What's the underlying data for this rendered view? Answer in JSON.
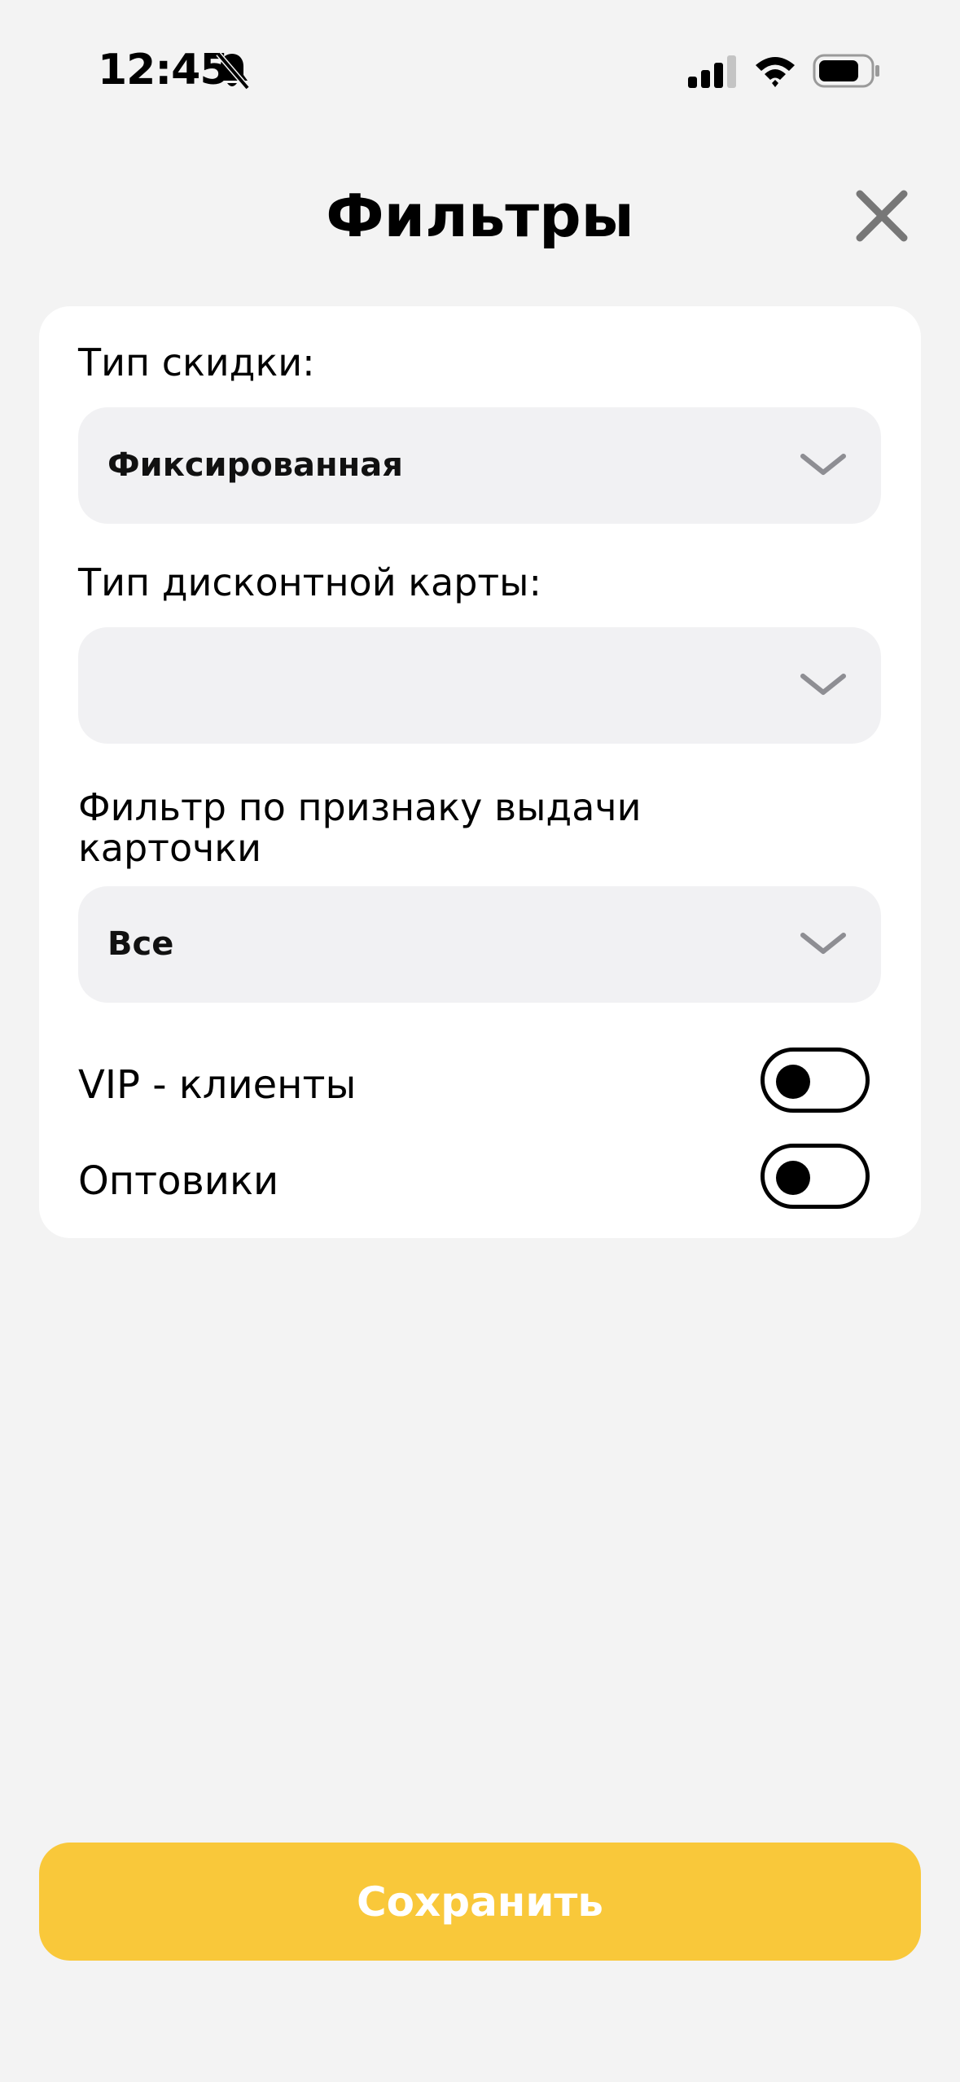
{
  "status_bar": {
    "time": "12:45",
    "icons": [
      "bell-slash-icon",
      "signal-icon",
      "wifi-icon",
      "battery-icon"
    ]
  },
  "header": {
    "title": "Фильтры",
    "close_icon": "close-icon"
  },
  "filters": {
    "discount_type": {
      "label": "Тип скидки:",
      "value": "Фиксированная"
    },
    "card_type": {
      "label": "Тип дисконтной карты:",
      "value": ""
    },
    "issue_filter": {
      "label_line1": "Фильтр по признаку выдачи",
      "label_line2": "карточки",
      "value": "Все"
    },
    "toggles": [
      {
        "label": "VIP - клиенты",
        "on": false
      },
      {
        "label": "Оптовики",
        "on": false
      }
    ]
  },
  "footer": {
    "save_label": "Сохранить"
  },
  "colors": {
    "background": "#f3f3f3",
    "card": "#ffffff",
    "select_bg": "#f1f1f3",
    "accent": "#f9c83a",
    "close_icon": "#777777",
    "chevron": "#8e8e93"
  }
}
